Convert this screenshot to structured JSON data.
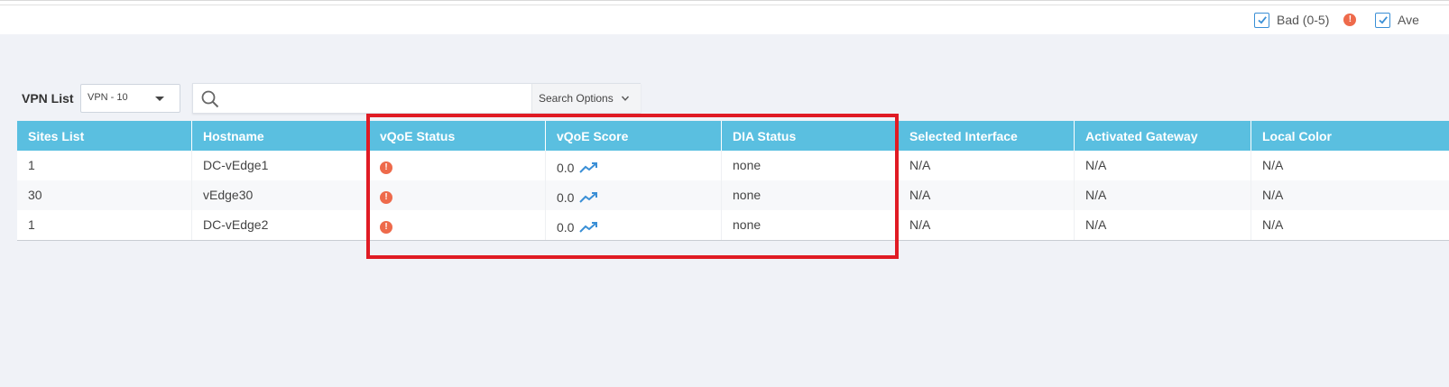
{
  "legend": {
    "items": [
      {
        "label": "Bad (0-5)",
        "checked": true
      },
      {
        "label": "Ave",
        "checked": true
      }
    ],
    "bad_icon": "alert-icon",
    "bad_color": "#ee6a4b"
  },
  "toolbar": {
    "vpn_label": "VPN List",
    "vpn_selected": "VPN - 10",
    "search_placeholder": "",
    "search_value": "",
    "search_options_label": "Search Options"
  },
  "table": {
    "columns": [
      "Sites List",
      "Hostname",
      "vQoE Status",
      "vQoE Score",
      "DIA Status",
      "Selected Interface",
      "Activated Gateway",
      "Local Color"
    ],
    "rows": [
      {
        "site": "1",
        "hostname": "DC-vEdge1",
        "status_icon": "alert-icon",
        "score": "0.0",
        "dia": "none",
        "interface": "N/A",
        "gateway": "N/A",
        "color": "N/A"
      },
      {
        "site": "30",
        "hostname": "vEdge30",
        "status_icon": "alert-icon",
        "score": "0.0",
        "dia": "none",
        "interface": "N/A",
        "gateway": "N/A",
        "color": "N/A"
      },
      {
        "site": "1",
        "hostname": "DC-vEdge2",
        "status_icon": "alert-icon",
        "score": "0.0",
        "dia": "none",
        "interface": "N/A",
        "gateway": "N/A",
        "color": "N/A"
      }
    ]
  },
  "colors": {
    "header_bg": "#5abfe0",
    "alert": "#ee6a4b",
    "highlight": "#e01b24",
    "trend": "#3a8fd6"
  }
}
